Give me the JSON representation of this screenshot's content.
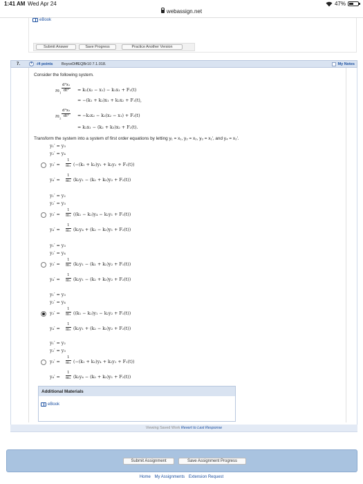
{
  "status_bar": {
    "time": "1:41 AM",
    "date": "Wed Apr 24",
    "battery": "47%",
    "battery_level": 0.47
  },
  "browser": {
    "url": "webassign.net"
  },
  "previous_question": {
    "ebook_label": "eBook",
    "buttons": [
      "Submit Answer",
      "Save Progress",
      "Practice Another Version"
    ]
  },
  "question": {
    "number": "7.",
    "points": "-/4 points",
    "code": "BoyceDiffEQBr10 7.1.018.",
    "my_notes": "My Notes",
    "prompt": "Consider the following system.",
    "system": {
      "l1_lhs_coef": "m",
      "l1_lhs_sub": "1",
      "l1_num": "d²x₁",
      "l1_den": "dt²",
      "l1_rhs": "= k₂(x₂ − x₁) − k₁x₁ + F₁(t)",
      "l2_rhs": "= −(k₁ + k₂)x₁ + k₂x₂ + F₁(t),",
      "l3_lhs_coef": "m",
      "l3_lhs_sub": "2",
      "l3_num": "d²x₂",
      "l3_den": "dt²",
      "l3_rhs": "= −k₃x₂ − k₂(x₂ − x₁) + F₂(t)",
      "l4_rhs": "= k₂x₁ − (k₂ + k₃)x₂ + F₂(t)."
    },
    "instruction": "Transform the system into a system of first order equations by letting  y₁ = x₁,  y₂ = x₂,  y₃ = x₁′,  and  y₄ = x₂′.",
    "options": [
      {
        "line1": "y₁′ = y₃",
        "line2": "y₂′ = y₄",
        "y3_lhs": "y₃′ =",
        "y3_num": "1",
        "y3_den": "m₁",
        "y3_rhs": "(−(k₁ + k₂)y₁ + k₂y₂ + F₁(t))",
        "y4_lhs": "y₄′ =",
        "y4_num": "1",
        "y4_den": "m₂",
        "y4_rhs": "(k₂y₁ − (k₂ + k₃)y₂ + F₂(t))",
        "selected": false
      },
      {
        "line1": "y₁′ = y₂",
        "line2": "y₂′ = y₃",
        "y3_lhs": "y₃′ =",
        "y3_num": "1",
        "y3_den": "m₁",
        "y3_rhs": "((k₁ − k₂)y₄ − k₂y₁ + F₁(t))",
        "y4_lhs": "y₄′ =",
        "y4_num": "1",
        "y4_den": "m₂",
        "y4_rhs": "(k₂y₄ + (k₂ − k₃)y₁ + F₂(t))",
        "selected": false
      },
      {
        "line1": "y₁′ = y₃",
        "line2": "y₂′ = y₄",
        "y3_lhs": "y₃′ =",
        "y3_num": "1",
        "y3_den": "m₁",
        "y3_rhs": "(k₂y₁ − (k₁ + k₂)y₂ + F₁(t))",
        "y4_lhs": "y₄′ =",
        "y4_num": "1",
        "y4_den": "m₂",
        "y4_rhs": "(k₂y₁ − (k₂ + k₃)y₂ + F₂(t))",
        "selected": false
      },
      {
        "line1": "y₁′ = y₃",
        "line2": "y₂′ = y₄",
        "y3_lhs": "y₃′ =",
        "y3_num": "1",
        "y3_den": "m₁",
        "y3_rhs": "((k₁ − k₂)y₁ − k₂y₂ + F₁(t))",
        "y4_lhs": "y₄′ =",
        "y4_num": "1",
        "y4_den": "m₂",
        "y4_rhs": "(k₂y₁ + (k₂ − k₃)y₂ + F₂(t))",
        "selected": true
      },
      {
        "line1": "y₁′ = y₂",
        "line2": "y₂′ = y₃",
        "y3_lhs": "y₃′ =",
        "y3_num": "1",
        "y3_den": "m₁",
        "y3_rhs": "(−(k₁ + k₂)y₄ + k₂y₁ + F₁(t))",
        "y4_lhs": "y₄′ =",
        "y4_num": "1",
        "y4_den": "m₂",
        "y4_rhs": "(k₂y₄ − (k₂ + k₃)y₁ + F₂(t))",
        "selected": false
      }
    ],
    "additional_materials": {
      "title": "Additional Materials",
      "ebook_label": "eBook"
    },
    "footer": {
      "viewing": "Viewing Saved Work",
      "revert": "Revert to Last Response"
    }
  },
  "assignment_buttons": [
    "Submit Assignment",
    "Save Assignment Progress"
  ],
  "bottom_links": [
    "Home",
    "My Assignments",
    "Extension Request"
  ]
}
